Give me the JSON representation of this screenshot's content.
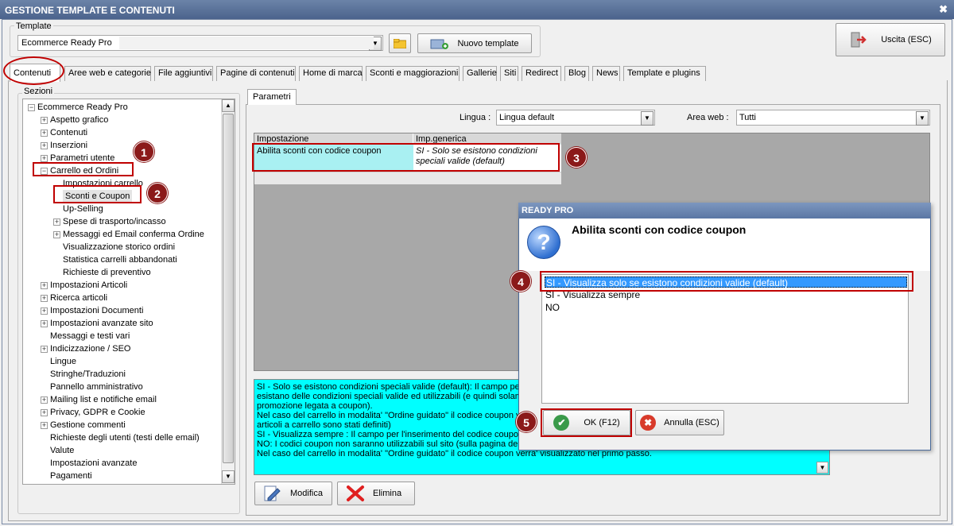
{
  "window": {
    "title": "GESTIONE TEMPLATE E CONTENUTI",
    "close_glyph": "✖"
  },
  "template": {
    "legend": "Template",
    "value": "Ecommerce Ready Pro",
    "new_template_label": "Nuovo template",
    "exit_label": "Uscita (ESC)"
  },
  "tabs": [
    {
      "label": "Contenuti",
      "active": true
    },
    {
      "label": "Aree web e categorie"
    },
    {
      "label": "File aggiuntivi"
    },
    {
      "label": "Pagine di contenuti"
    },
    {
      "label": "Home di marca"
    },
    {
      "label": "Sconti e maggiorazioni"
    },
    {
      "label": "Gallerie"
    },
    {
      "label": "Siti"
    },
    {
      "label": "Redirect"
    },
    {
      "label": "Blog"
    },
    {
      "label": "News"
    },
    {
      "label": "Template e plugins"
    }
  ],
  "sections": {
    "legend": "Sezioni",
    "tree": [
      {
        "label": "Ecommerce Ready Pro",
        "level": 0,
        "expander": "−"
      },
      {
        "label": "Aspetto grafico",
        "level": 1,
        "expander": "+"
      },
      {
        "label": "Contenuti",
        "level": 1,
        "expander": "+"
      },
      {
        "label": "Inserzioni",
        "level": 1,
        "expander": "+"
      },
      {
        "label": "Parametri utente",
        "level": 1,
        "expander": "+"
      },
      {
        "label": "Carrello ed Ordini",
        "level": 1,
        "expander": "−"
      },
      {
        "label": "Impostazioni carrello",
        "level": 2,
        "expander": ""
      },
      {
        "label": "Sconti e Coupon",
        "level": 2,
        "expander": "",
        "selected": true
      },
      {
        "label": "Up-Selling",
        "level": 2,
        "expander": ""
      },
      {
        "label": "Spese di trasporto/incasso",
        "level": 2,
        "expander": "+"
      },
      {
        "label": "Messaggi ed Email conferma Ordine",
        "level": 2,
        "expander": "+"
      },
      {
        "label": "Visualizzazione storico ordini",
        "level": 2,
        "expander": ""
      },
      {
        "label": "Statistica carrelli abbandonati",
        "level": 2,
        "expander": ""
      },
      {
        "label": "Richieste di preventivo",
        "level": 2,
        "expander": ""
      },
      {
        "label": "Impostazioni Articoli",
        "level": 1,
        "expander": "+"
      },
      {
        "label": "Ricerca articoli",
        "level": 1,
        "expander": "+"
      },
      {
        "label": "Impostazioni Documenti",
        "level": 1,
        "expander": "+"
      },
      {
        "label": "Impostazioni avanzate sito",
        "level": 1,
        "expander": "+"
      },
      {
        "label": "Messaggi e testi vari",
        "level": 1,
        "expander": ""
      },
      {
        "label": "Indicizzazione / SEO",
        "level": 1,
        "expander": "+"
      },
      {
        "label": "Lingue",
        "level": 1,
        "expander": ""
      },
      {
        "label": "Stringhe/Traduzioni",
        "level": 1,
        "expander": ""
      },
      {
        "label": "Pannello amministrativo",
        "level": 1,
        "expander": ""
      },
      {
        "label": "Mailing list e notifiche email",
        "level": 1,
        "expander": "+"
      },
      {
        "label": "Privacy, GDPR e Cookie",
        "level": 1,
        "expander": "+"
      },
      {
        "label": "Gestione commenti",
        "level": 1,
        "expander": "+"
      },
      {
        "label": "Richieste degli utenti (testi delle email)",
        "level": 1,
        "expander": ""
      },
      {
        "label": "Valute",
        "level": 1,
        "expander": ""
      },
      {
        "label": "Impostazioni avanzate",
        "level": 1,
        "expander": ""
      },
      {
        "label": "Pagamenti",
        "level": 1,
        "expander": ""
      }
    ]
  },
  "params": {
    "tab_label": "Parametri",
    "lingua_label": "Lingua :",
    "lingua_value": "Lingua default",
    "area_label": "Area web :",
    "area_value": "Tutti",
    "col_setting": "Impostazione",
    "col_generic": "Imp.generica",
    "row_setting": "Abilita sconti con codice coupon",
    "row_value": "SI - Solo se esistono condizioni speciali valide (default)",
    "description_lines": [
      "SI - Solo se esistono condizioni speciali valide (default): Il campo per l",
      "esistano delle condizioni speciali valide ed utilizzabili (e quindi solamen",
      "promozione legata a coupon).",
      "Nel caso del carrello in modalita' \"Ordine guidato\" il codice coupon ver",
      "articoli a carrello sono stati definiti)",
      "SI - Visualizza sempre : Il campo per l'inserimento del codice coupon v",
      "NO: I codici coupon non saranno utilizzabili sul sito (sulla pagina del ca",
      "Nel caso del carrello in modalita' \"Ordine guidato\" il codice coupon verra' visualizzato nel primo passo."
    ],
    "modifica_label": "Modifica",
    "elimina_label": "Elimina"
  },
  "dialog": {
    "title": "READY PRO",
    "heading": "Abilita sconti con codice coupon",
    "options": [
      {
        "label": "SI - Visualizza solo se esistono condizioni valide (default)",
        "selected": true
      },
      {
        "label": "SI - Visualizza sempre"
      },
      {
        "label": "NO"
      }
    ],
    "ok_label": "OK (F12)",
    "cancel_label": "Annulla (ESC)"
  },
  "annotations": [
    "1",
    "2",
    "3",
    "4",
    "5"
  ],
  "colors": {
    "highlight_red": "#c00000",
    "badge": "#8b1a1a",
    "selection": "#3399ff",
    "cyan_cell": "#a9f0f2",
    "description_bg": "#00ffff"
  }
}
